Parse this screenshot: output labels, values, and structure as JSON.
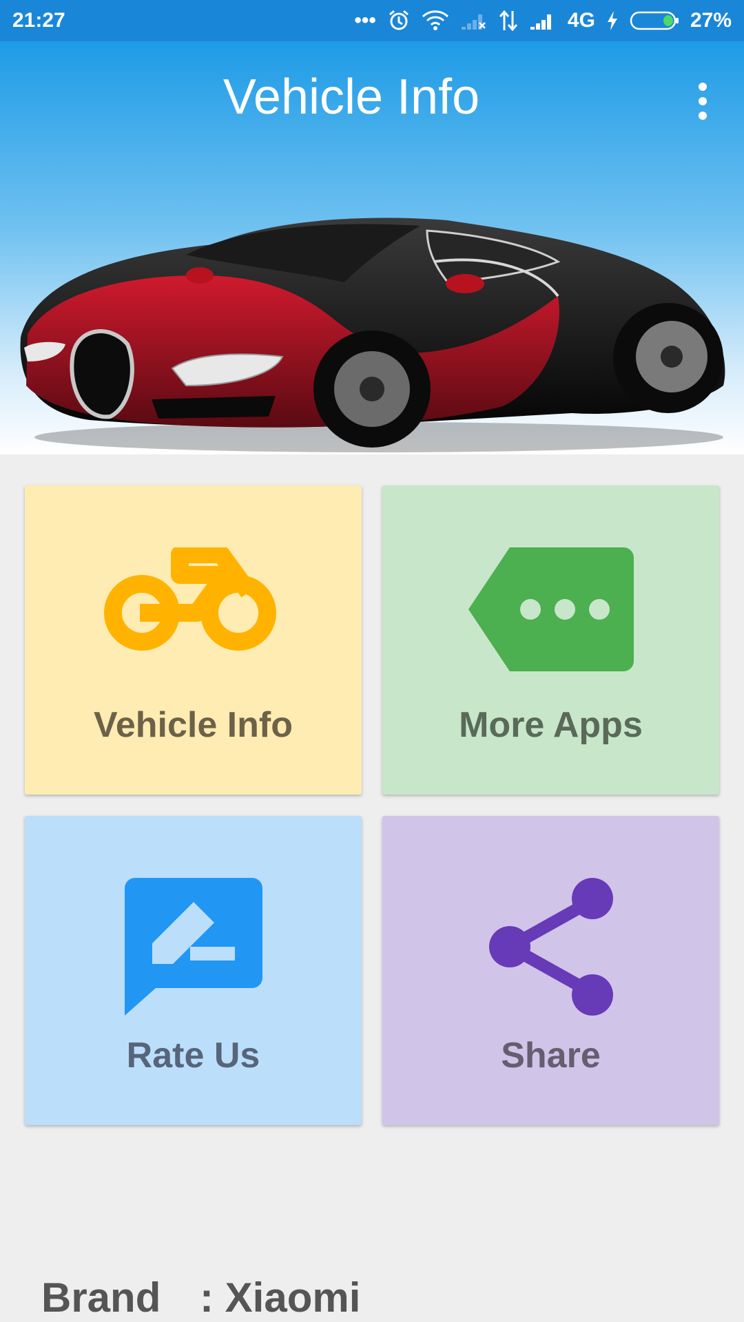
{
  "status_bar": {
    "time": "21:27",
    "network_type": "4G",
    "battery": "27%",
    "battery_level": 0.27
  },
  "app_bar": {
    "title": "Vehicle Info"
  },
  "tiles": [
    {
      "label": "Vehicle Info",
      "icon": "motorcycle-icon",
      "bg": "#ffecb3",
      "icon_color": "#ffb300"
    },
    {
      "label": "More Apps",
      "icon": "more-apps-label-icon",
      "bg": "#c8e6c9",
      "icon_color": "#4caf50"
    },
    {
      "label": "Rate Us",
      "icon": "rate-review-icon",
      "bg": "#bbdefb",
      "icon_color": "#2196f3"
    },
    {
      "label": "Share",
      "icon": "share-icon",
      "bg": "#d1c4e9",
      "icon_color": "#673ab7"
    }
  ],
  "device_info": {
    "key": "Brand",
    "value": ": Xiaomi"
  }
}
